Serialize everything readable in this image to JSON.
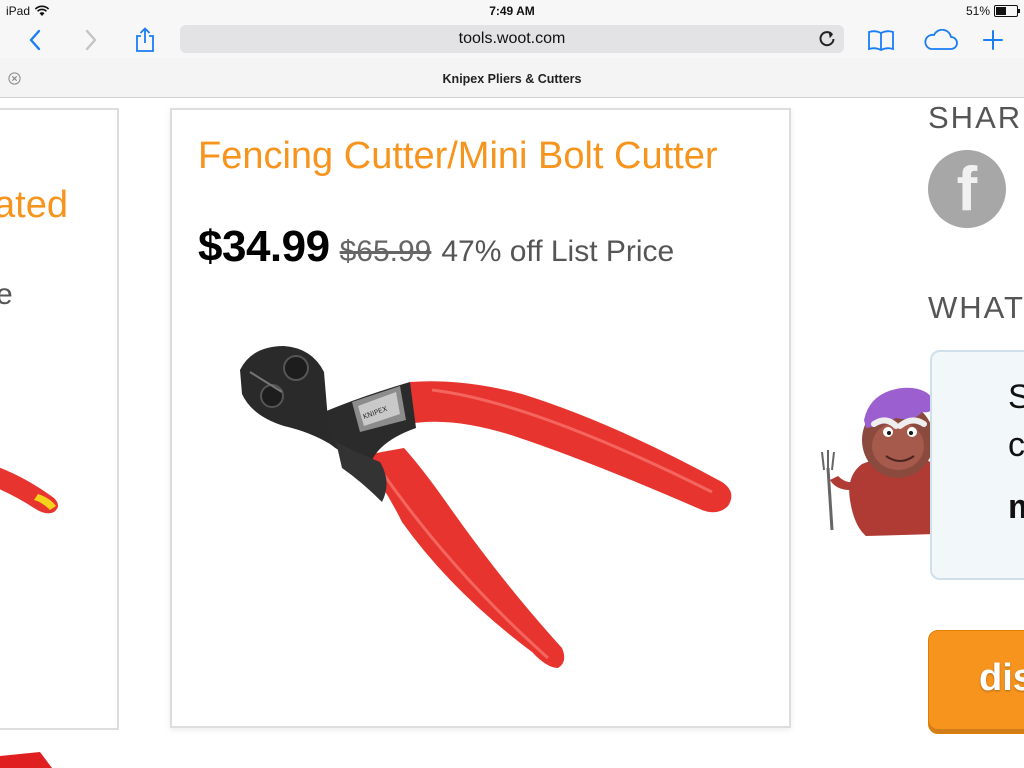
{
  "status_bar": {
    "device": "iPad",
    "time": "7:49 AM",
    "battery": "51%",
    "battery_level": 0.51
  },
  "toolbar": {
    "url": "tools.woot.com"
  },
  "tab": {
    "title": "Knipex Pliers & Cutters"
  },
  "left_card": {
    "title_fragment": "ated",
    "subtitle_fragment": "e"
  },
  "product": {
    "title": "Fencing Cutter/Mini Bolt Cutter",
    "price": "$34.99",
    "list_price": "$65.99",
    "discount": "47% off List Price",
    "brand_marking": "KNIPEX"
  },
  "sidebar": {
    "share_heading": "SHAR",
    "facebook_glyph": "f",
    "what_heading": "WHAT",
    "bubble_line1": "S",
    "bubble_line2": "c",
    "bubble_line3": "m",
    "button_label": "dis"
  },
  "colors": {
    "accent_orange": "#f7941d",
    "ios_blue": "#1a7ef5",
    "handle_red": "#e8342f"
  }
}
